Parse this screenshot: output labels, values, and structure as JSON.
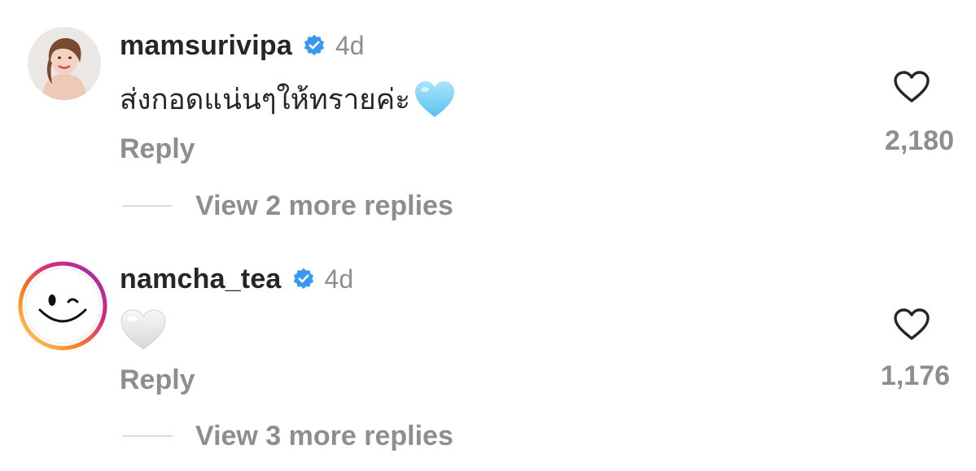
{
  "comments": [
    {
      "username": "mamsurivipa",
      "verified": true,
      "timestamp": "4d",
      "text": "ส่งกอดแน่นๆให้ทรายค่ะ",
      "emoji": "light-blue-heart",
      "reply_label": "Reply",
      "like_count": "2,180",
      "view_replies_label": "View 2 more replies"
    },
    {
      "username": "namcha_tea",
      "verified": true,
      "timestamp": "4d",
      "text": "",
      "emoji": "white-heart",
      "reply_label": "Reply",
      "like_count": "1,176",
      "view_replies_label": "View 3 more replies"
    }
  ],
  "colors": {
    "primary_text": "#262626",
    "secondary_text": "#8e8e8e",
    "verified_blue": "#3897f0",
    "divider": "#dbdbdb",
    "light_blue_heart": "#7fd0f5",
    "white_heart": "#e6e6e6"
  },
  "icons": {
    "verified": "verified-badge-icon",
    "like": "heart-outline-icon"
  }
}
